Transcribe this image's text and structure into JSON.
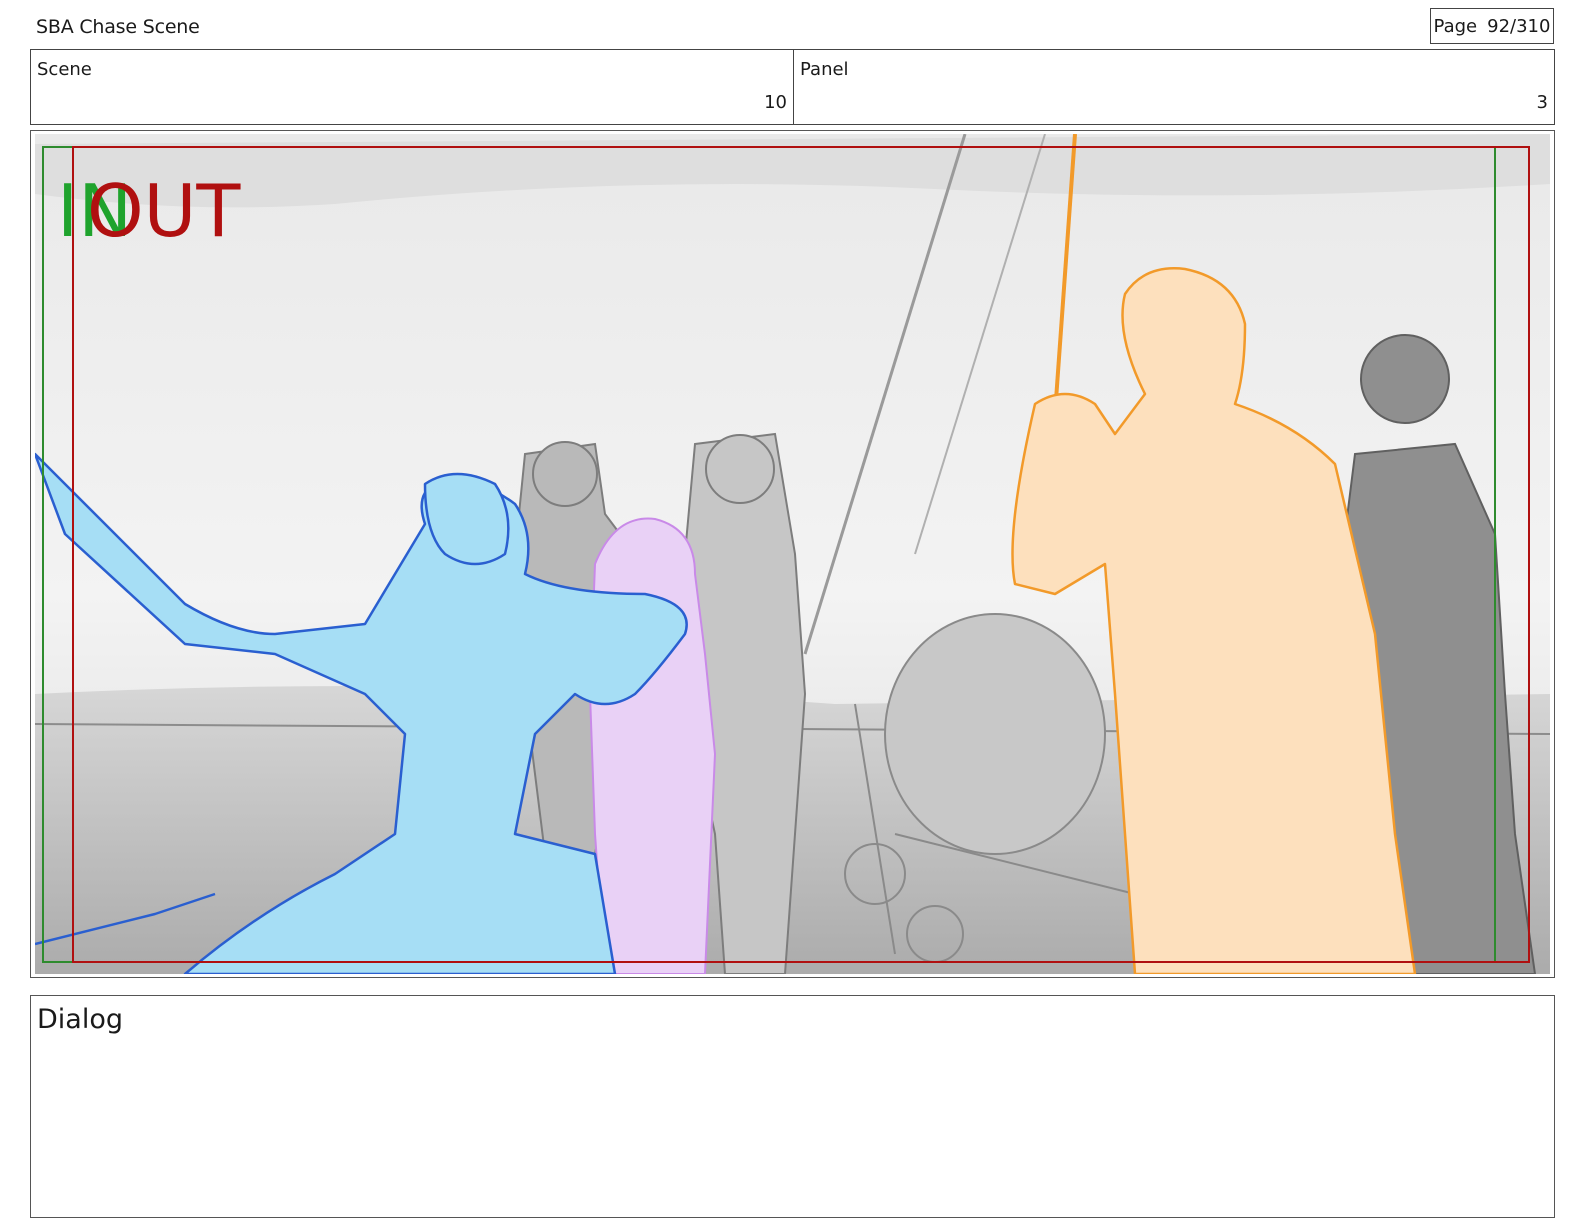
{
  "document": {
    "title": "SBA Chase Scene",
    "page_label": "Page",
    "page_value": "92/310"
  },
  "meta": {
    "scene_label": "Scene",
    "scene_value": "10",
    "panel_label": "Panel",
    "panel_value": "3"
  },
  "frame": {
    "in_marker": "IN",
    "out_marker": "OUT",
    "colors": {
      "in_marker": "#1fa32d",
      "out_marker": "#b01010",
      "blue_character": "#a6def5",
      "blue_line": "#2a5fd0",
      "pink_character": "#e9d1f6",
      "orange_character": "#fde0bd",
      "orange_line": "#f29a2a",
      "background_gray": "#d6d6d6"
    }
  },
  "dialog": {
    "label": "Dialog"
  }
}
